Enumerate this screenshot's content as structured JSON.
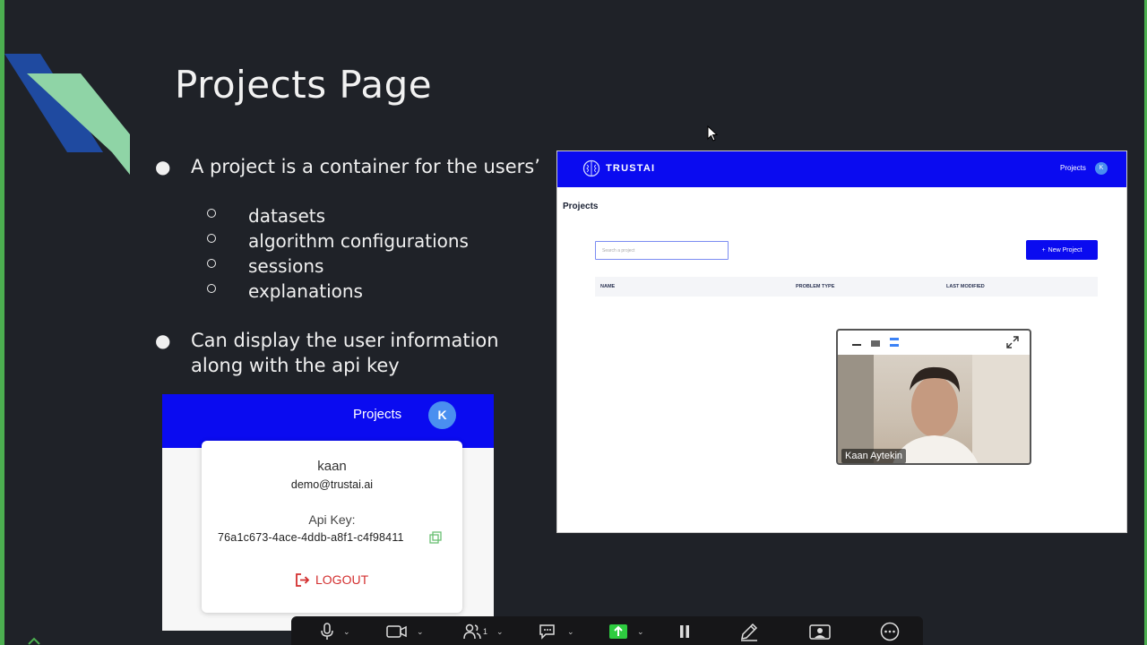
{
  "slide": {
    "title": "Projects Page",
    "bullets": [
      {
        "text": "A project is a container for the users’"
      },
      {
        "text": "Can display the user information along with the api key"
      }
    ],
    "sub_bullets": [
      "datasets",
      "algorithm configurations",
      "sessions",
      "explanations"
    ]
  },
  "user_card": {
    "nav_label": "Projects",
    "avatar_initial": "K",
    "name": "kaan",
    "email": "demo@trustai.ai",
    "api_key_label": "Api Key:",
    "api_key": "76a1c673-4ace-4ddb-a8f1-c4f98411",
    "logout_label": "LOGOUT"
  },
  "app": {
    "brand": "TRUSTAI",
    "nav_projects": "Projects",
    "avatar_initial": "K",
    "heading": "Projects",
    "search_placeholder": "Search a project",
    "new_project_label": "New Project",
    "columns": [
      "NAME",
      "PROBLEM TYPE",
      "LAST MODIFIED"
    ]
  },
  "video": {
    "participant_name": "Kaan Aytekin"
  },
  "meeting_bar": {
    "participants_count": "1"
  },
  "colors": {
    "brand_blue": "#0a0bf0",
    "avatar_blue": "#4a8ff0",
    "logout_red": "#d32f2f",
    "share_green": "#2ecc40",
    "background": "#1f2228"
  },
  "icons": [
    "mic-icon",
    "camera-icon",
    "participants-icon",
    "chat-icon",
    "share-screen-icon",
    "pause-icon",
    "annotate-icon",
    "whiteboard-icon",
    "more-icon",
    "copy-icon",
    "logout-icon",
    "brain-logo-icon",
    "expand-icon",
    "plus-icon"
  ]
}
